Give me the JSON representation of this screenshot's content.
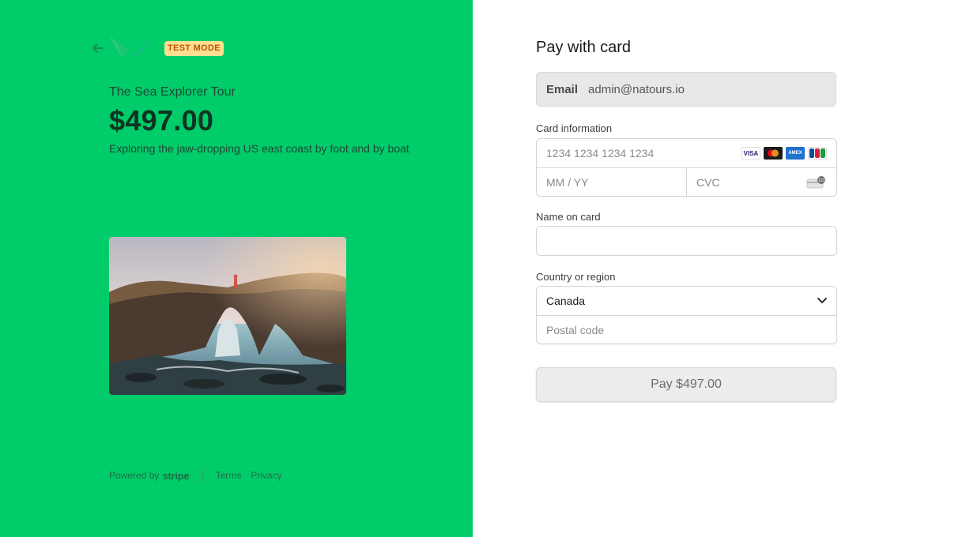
{
  "colors": {
    "left_bg": "#00cc6a",
    "badge_bg": "#ffde92",
    "badge_text": "#bb5504"
  },
  "left": {
    "badge": "TEST MODE",
    "product_name": "The Sea Explorer Tour",
    "price": "$497.00",
    "description": "Exploring the jaw-dropping US east coast by foot and by boat",
    "footer": {
      "powered_by": "Powered by",
      "brand": "stripe",
      "terms": "Terms",
      "privacy": "Privacy"
    }
  },
  "form": {
    "title": "Pay with card",
    "email_label": "Email",
    "email_value": "admin@natours.io",
    "card_label": "Card information",
    "card_number_placeholder": "1234 1234 1234 1234",
    "expiry_placeholder": "MM / YY",
    "cvc_placeholder": "CVC",
    "card_brands": [
      "VISA",
      "mastercard",
      "amex",
      "JCB"
    ],
    "name_label": "Name on card",
    "country_label": "Country or region",
    "country_value": "Canada",
    "postal_placeholder": "Postal code",
    "pay_button": "Pay $497.00"
  }
}
